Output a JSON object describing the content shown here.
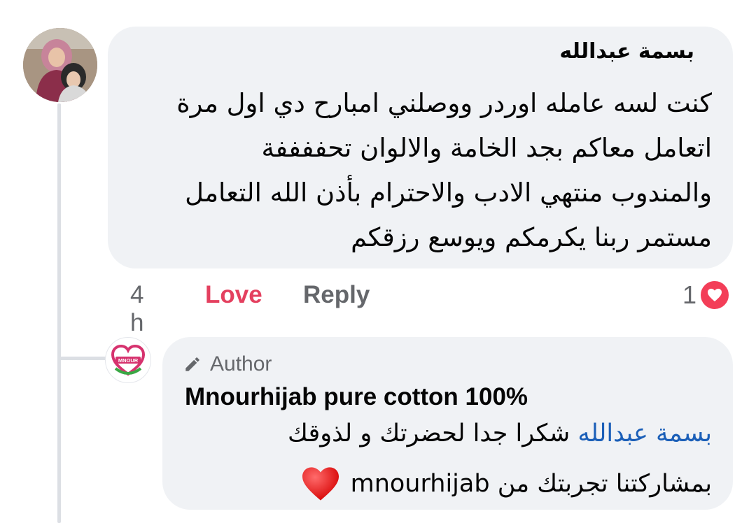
{
  "comment": {
    "author": "بسمة عبدالله",
    "lines": [
      "كنت لسه عامله اوردر ووصلني امبارح   دي اول مرة",
      "اتعامل معاكم   بجد الخامة والالوان تحففففة",
      "والمندوب منتهي الادب والاحترام   بأذن الله التعامل",
      "مستمر  ربنا يكرمكم ويوسع رزقكم"
    ],
    "time": "4 h",
    "love_label": "Love",
    "reply_label": "Reply",
    "reaction_count": "1",
    "reaction_icon": "heart-icon"
  },
  "reply": {
    "badge": "Author",
    "badge_icon": "pencil-icon",
    "author": "Mnourhijab pure cotton 100%",
    "avatar_text": "MNOUR",
    "mention": "بسمة عبدالله",
    "line1_text": "شكرا جدا لحضرتك و لذوقك",
    "line2_text": "بمشاركتنا تجربتك من mnourhijab",
    "emoji": "red-heart-emoji"
  },
  "colors": {
    "bubble": "#f0f2f5",
    "love": "#e4405f",
    "meta": "#65676b",
    "mention": "#1b5fb8",
    "reaction": "#f33e58"
  }
}
